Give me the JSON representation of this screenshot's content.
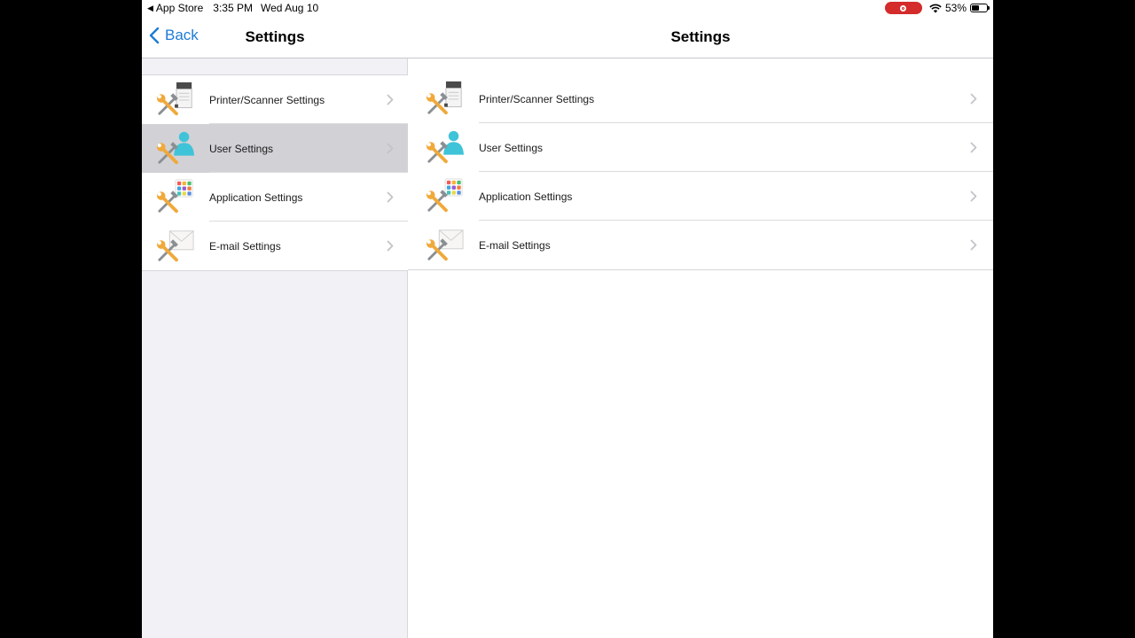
{
  "status_bar": {
    "back_app": "App Store",
    "time": "3:35 PM",
    "date": "Wed Aug 10",
    "battery_percent": "53%",
    "battery_level": 0.53,
    "recording_color": "#d42b2b"
  },
  "master": {
    "back_label": "Back",
    "title": "Settings",
    "selected_index": 1,
    "items": [
      {
        "label": "Printer/Scanner Settings",
        "icon": "printer-scanner-settings-icon"
      },
      {
        "label": "User Settings",
        "icon": "user-settings-icon"
      },
      {
        "label": "Application Settings",
        "icon": "application-settings-icon"
      },
      {
        "label": "E-mail Settings",
        "icon": "email-settings-icon"
      }
    ]
  },
  "detail": {
    "title": "Settings",
    "items": [
      {
        "label": "Printer/Scanner Settings",
        "icon": "printer-scanner-settings-icon"
      },
      {
        "label": "User Settings",
        "icon": "user-settings-icon"
      },
      {
        "label": "Application Settings",
        "icon": "application-settings-icon"
      },
      {
        "label": "E-mail Settings",
        "icon": "email-settings-icon"
      }
    ]
  },
  "colors": {
    "accent": "#1d7bd6",
    "selected_row": "#d1d1d6",
    "tool_orange": "#f0a93a",
    "tool_gray": "#8a8f94",
    "user_cyan": "#3fc3d8"
  }
}
